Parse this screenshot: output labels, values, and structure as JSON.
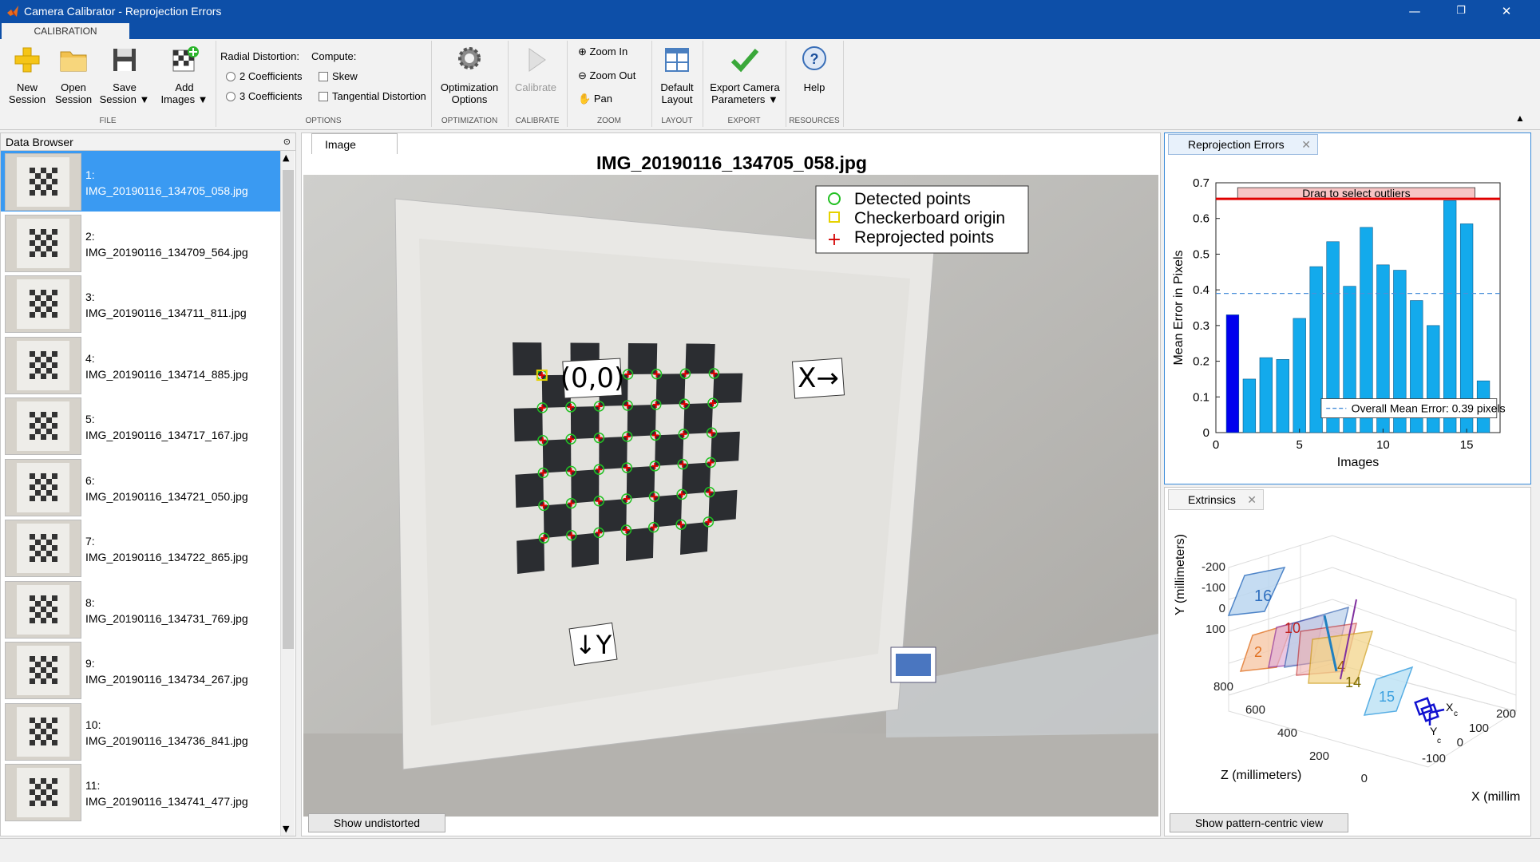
{
  "window": {
    "title": "Camera Calibrator - Reprojection Errors",
    "minimize": "—",
    "maximize": "❐",
    "close": "✕"
  },
  "ribbon": {
    "tab": "CALIBRATION",
    "new_session": [
      "New",
      "Session"
    ],
    "open_session": [
      "Open",
      "Session"
    ],
    "save_session": [
      "Save",
      "Session ▼"
    ],
    "add_images": [
      "Add",
      "Images ▼"
    ],
    "radial_label": "Radial Distortion:",
    "coef2": "2 Coefficients",
    "coef3": "3 Coefficients",
    "compute_label": "Compute:",
    "skew": "Skew",
    "tangential": "Tangential Distortion",
    "optimization": [
      "Optimization",
      "Options"
    ],
    "calibrate": "Calibrate",
    "zoom_in": "Zoom In",
    "zoom_out": "Zoom Out",
    "pan": "Pan",
    "default_layout": [
      "Default",
      "Layout"
    ],
    "export": [
      "Export Camera",
      "Parameters ▼"
    ],
    "help": "Help",
    "sections": {
      "file": "FILE",
      "options": "OPTIONS",
      "optimization": "OPTIMIZATION",
      "calibrate": "CALIBRATE",
      "zoom": "ZOOM",
      "layout": "LAYOUT",
      "export": "EXPORT",
      "resources": "RESOURCES"
    }
  },
  "browser": {
    "title": "Data Browser",
    "items": [
      {
        "num": "1:",
        "name": "IMG_20190116_134705_058.jpg"
      },
      {
        "num": "2:",
        "name": "IMG_20190116_134709_564.jpg"
      },
      {
        "num": "3:",
        "name": "IMG_20190116_134711_811.jpg"
      },
      {
        "num": "4:",
        "name": "IMG_20190116_134714_885.jpg"
      },
      {
        "num": "5:",
        "name": "IMG_20190116_134717_167.jpg"
      },
      {
        "num": "6:",
        "name": "IMG_20190116_134721_050.jpg"
      },
      {
        "num": "7:",
        "name": "IMG_20190116_134722_865.jpg"
      },
      {
        "num": "8:",
        "name": "IMG_20190116_134731_769.jpg"
      },
      {
        "num": "9:",
        "name": "IMG_20190116_134734_267.jpg"
      },
      {
        "num": "10:",
        "name": "IMG_20190116_134736_841.jpg"
      },
      {
        "num": "11:",
        "name": "IMG_20190116_134741_477.jpg"
      }
    ]
  },
  "image_panel": {
    "tab": "Image",
    "title": "IMG_20190116_134705_058.jpg",
    "legend": [
      "Detected points",
      "Checkerboard origin",
      "Reprojected points"
    ],
    "origin_label": "(0,0)",
    "x_label": "X→",
    "y_label": "↓Y",
    "show_undistorted": "Show undistorted"
  },
  "reprojection": {
    "tab": "Reprojection Errors",
    "drag_text": "Drag to select outliers",
    "mean_label": "Overall Mean Error: 0.39 pixels"
  },
  "chart_data": {
    "type": "bar",
    "xlabel": "Images",
    "ylabel": "Mean Error in Pixels",
    "categories": [
      1,
      2,
      3,
      4,
      5,
      6,
      7,
      8,
      9,
      10,
      11,
      12,
      13,
      14,
      15,
      16
    ],
    "values": [
      0.33,
      0.15,
      0.21,
      0.205,
      0.32,
      0.465,
      0.535,
      0.41,
      0.575,
      0.47,
      0.455,
      0.37,
      0.3,
      0.65,
      0.585,
      0.145
    ],
    "selected_index": 0,
    "mean": 0.39,
    "outlier_threshold": 0.655,
    "ylim": [
      0,
      0.7
    ],
    "xlim": [
      0,
      17
    ],
    "yticks": [
      "0",
      "0.1",
      "0.2",
      "0.3",
      "0.4",
      "0.5",
      "0.6",
      "0.7"
    ],
    "xticks": [
      "0",
      "5",
      "10",
      "15"
    ],
    "colors": {
      "bar": "#13aaec",
      "selected": "#0000ee",
      "threshold": "#e00000",
      "mean": "#4a90d9"
    }
  },
  "extrinsics": {
    "tab": "Extrinsics",
    "ylabel": "Y (millimeters)",
    "zlabel": "Z (millimeters)",
    "xlabel": "X (millim",
    "yticks": [
      "-200",
      "-100",
      "0",
      "100"
    ],
    "zticks": [
      "800",
      "600",
      "400",
      "200",
      "0"
    ],
    "xticks": [
      "200",
      "100",
      "0",
      "-100"
    ],
    "board_labels": [
      "16",
      "10",
      "2",
      "4",
      "14",
      "15"
    ],
    "cam_x": "X",
    "cam_x_sub": "c",
    "cam_y": "Y",
    "cam_y_sub": "c",
    "pattern_view": "Show pattern-centric view"
  }
}
